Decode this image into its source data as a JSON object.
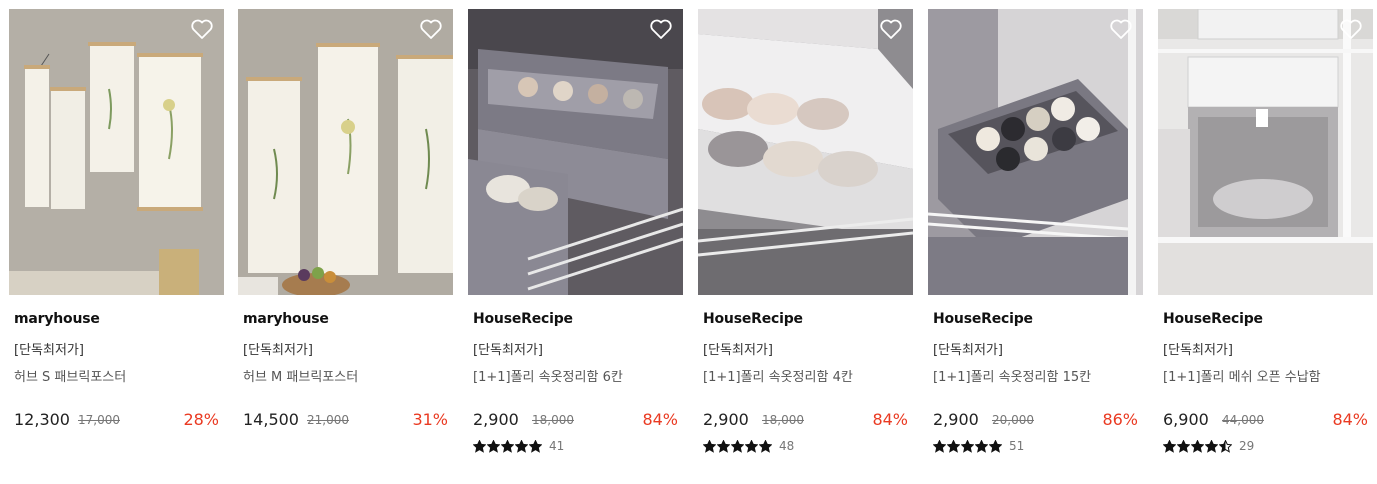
{
  "tag_label": "[단독최저가]",
  "products": [
    {
      "brand": "maryhouse",
      "tag": "[단독최저가]",
      "name": "허브 S 패브릭포스터",
      "price": "12,300",
      "original_price": "17,000",
      "discount": "28%",
      "rating": null,
      "review_count": null,
      "image": "fabric-herb-posters-wall"
    },
    {
      "brand": "maryhouse",
      "tag": "[단독최저가]",
      "name": "허브 M 패브릭포스터",
      "price": "14,500",
      "original_price": "21,000",
      "discount": "31%",
      "rating": null,
      "review_count": null,
      "image": "fabric-herb-posters-wall"
    },
    {
      "brand": "HouseRecipe",
      "tag": "[단독최저가]",
      "name": "[1+1]폴리 속옷정리함 6칸",
      "price": "2,900",
      "original_price": "18,000",
      "discount": "84%",
      "rating": 5,
      "review_count": "41",
      "image": "gray-underwear-organizer"
    },
    {
      "brand": "HouseRecipe",
      "tag": "[단독최저가]",
      "name": "[1+1]폴리 속옷정리함 4칸",
      "price": "2,900",
      "original_price": "18,000",
      "discount": "84%",
      "rating": 5,
      "review_count": "48",
      "image": "white-bra-organizer"
    },
    {
      "brand": "HouseRecipe",
      "tag": "[단독최저가]",
      "name": "[1+1]폴리 속옷정리함 15칸",
      "price": "2,900",
      "original_price": "20,000",
      "discount": "86%",
      "rating": 5,
      "review_count": "51",
      "image": "gray-sock-organizer"
    },
    {
      "brand": "HouseRecipe",
      "tag": "[단독최저가]",
      "name": "[1+1]폴리 메쉬 오픈 수납함",
      "price": "6,900",
      "original_price": "44,000",
      "discount": "84%",
      "rating": 4.5,
      "review_count": "29",
      "image": "white-mesh-storage-box"
    }
  ],
  "colors": {
    "discount": "#ea3a22",
    "star": "#111111",
    "text": "#222222",
    "muted": "#777777"
  },
  "icons": {
    "wishlist": "heart-outline-icon",
    "rating": "star-icon"
  }
}
